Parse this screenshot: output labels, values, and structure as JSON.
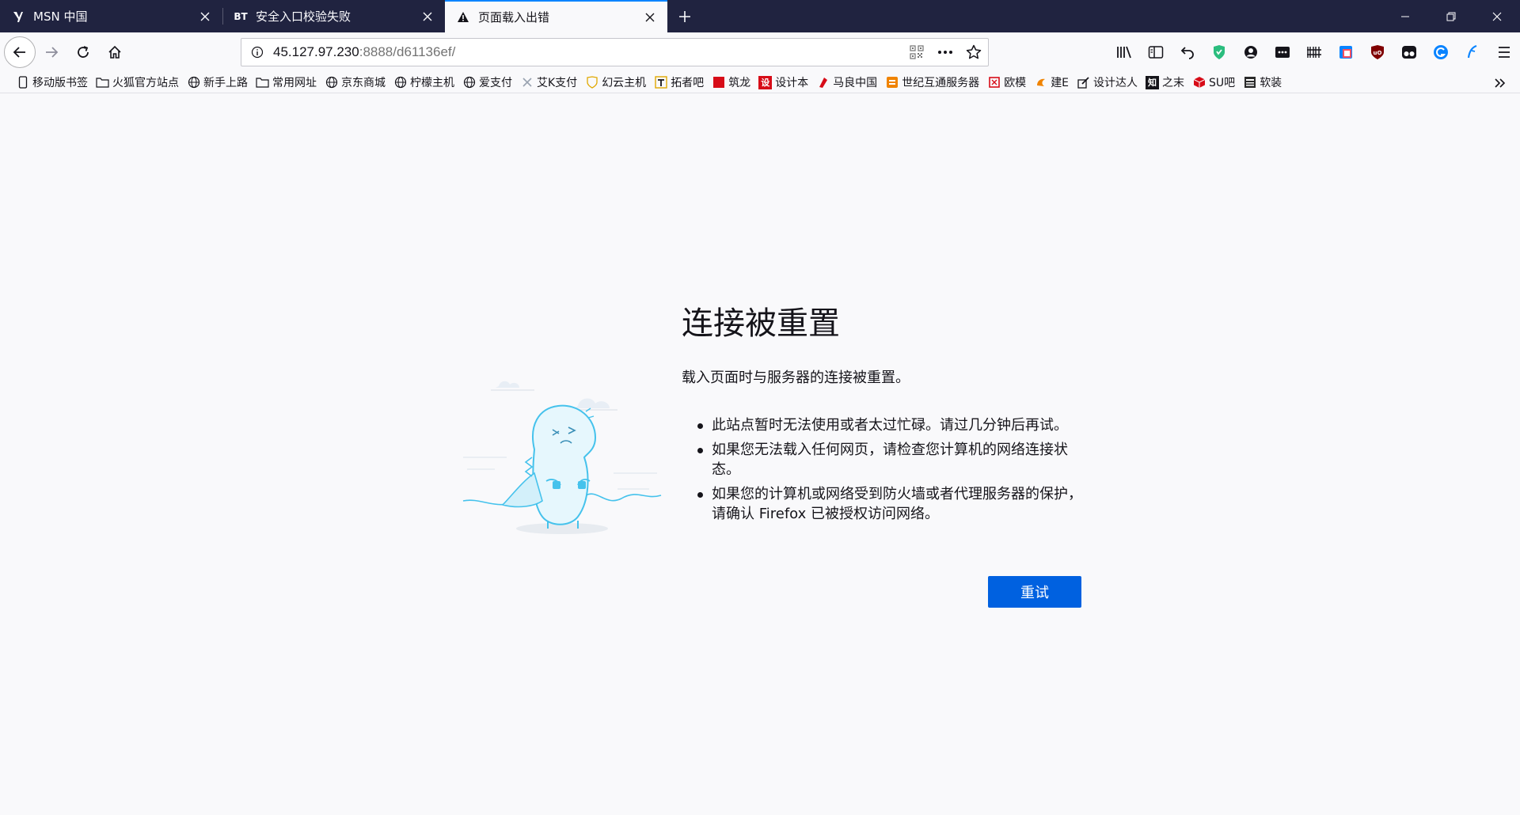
{
  "tabs": [
    {
      "title": "MSN 中国",
      "icon": "msn-icon",
      "active": false
    },
    {
      "title": "安全入口校验失败",
      "icon": "bt-icon",
      "icon_text": "BT",
      "active": false
    },
    {
      "title": "页面载入出错",
      "icon": "warning-icon",
      "active": true
    }
  ],
  "urlbar": {
    "host": "45.127.97.230",
    "rest": ":8888/d61136ef/"
  },
  "bookmarks": [
    {
      "label": "移动版书签",
      "icon": "mobile-icon"
    },
    {
      "label": "火狐官方站点",
      "icon": "folder-icon"
    },
    {
      "label": "新手上路",
      "icon": "globe-icon"
    },
    {
      "label": "常用网址",
      "icon": "folder-icon"
    },
    {
      "label": "京东商城",
      "icon": "globe-icon"
    },
    {
      "label": "柠檬主机",
      "icon": "globe-icon"
    },
    {
      "label": "爱支付",
      "icon": "globe-icon"
    },
    {
      "label": "艾K支付",
      "icon": "akpay-icon"
    },
    {
      "label": "幻云主机",
      "icon": "shield-icon"
    },
    {
      "label": "拓者吧",
      "icon": "tuozhe-icon"
    },
    {
      "label": "筑龙",
      "icon": "zhulong-icon"
    },
    {
      "label": "设计本",
      "icon": "shejiben-icon",
      "icon_text": "设"
    },
    {
      "label": "马良中国",
      "icon": "maliang-icon"
    },
    {
      "label": "世纪互通服务器",
      "icon": "server-icon"
    },
    {
      "label": "欧模",
      "icon": "oumo-icon"
    },
    {
      "label": "建E",
      "icon": "jiane-icon"
    },
    {
      "label": "设计达人",
      "icon": "pen-icon"
    },
    {
      "label": "之末",
      "icon": "zhi-icon",
      "icon_text": "知"
    },
    {
      "label": "SU吧",
      "icon": "cube-icon"
    },
    {
      "label": "软装",
      "icon": "arch-icon"
    }
  ],
  "error": {
    "title": "连接被重置",
    "description": "载入页面时与服务器的连接被重置。",
    "items": [
      "此站点暂时无法使用或者太过忙碌。请过几分钟后再试。",
      "如果您无法载入任何网页，请检查您计算机的网络连接状态。",
      "如果您的计算机或网络受到防火墙或者代理服务器的保护，请确认 Firefox 已被授权访问网络。"
    ],
    "retry_label": "重试"
  },
  "colors": {
    "tabstrip": "#202340",
    "accent": "#0a84ff",
    "button": "#0061e0"
  }
}
